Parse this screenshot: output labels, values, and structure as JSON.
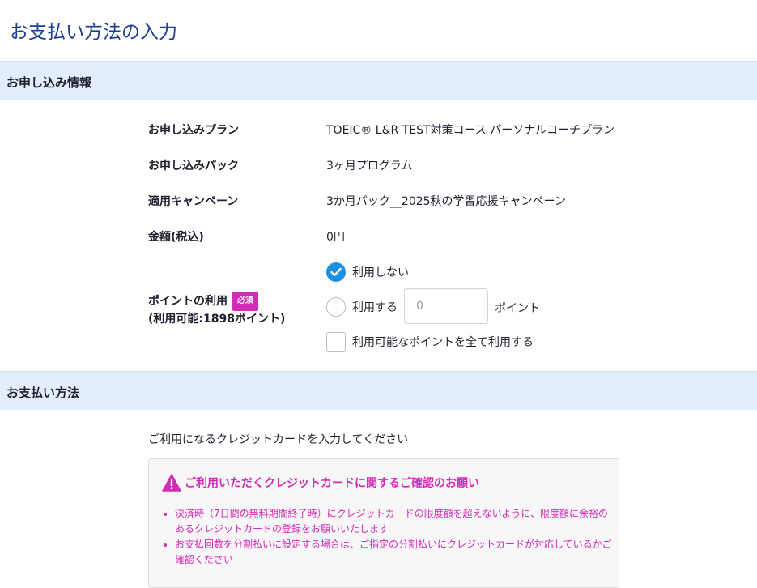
{
  "page": {
    "title": "お支払い方法の入力"
  },
  "application_section": {
    "header": "お申し込み情報",
    "rows": [
      {
        "label": "お申し込みプラン",
        "value": "TOEIC® L&R TEST対策コース パーソナルコーチプラン"
      },
      {
        "label": "お申し込みパック",
        "value": "3ヶ月プログラム"
      },
      {
        "label": "適用キャンペーン",
        "value": "3か月パック__2025秋の学習応援キャンペーン"
      },
      {
        "label": "金額(税込)",
        "value": "0円"
      }
    ],
    "points": {
      "label": "ポイントの利用",
      "required_badge": "必須",
      "available": "(利用可能:1898ポイント)",
      "option_not_use": "利用しない",
      "option_use": "利用する",
      "input_placeholder": "0",
      "unit": "ポイント",
      "use_all_label": "利用可能なポイントを全て利用する",
      "selected": "not_use"
    }
  },
  "payment_section": {
    "header": "お支払い方法",
    "instruction": "ご利用になるクレジットカードを入力してください",
    "notice": {
      "title": "ご利用いただくクレジットカードに関するご確認のお願い",
      "items": [
        "決済時（7日間の無料期間終了時）にクレジットカードの限度額を超えないように、限度額に余裕のあるクレジットカードの登録をお願いいたします",
        "お支払回数を分割払いに設定する場合は、ご指定の分割払いにクレジットカードが対応しているかご確認ください"
      ]
    }
  },
  "colors": {
    "title": "#1c3f8f",
    "section_bg": "#e3eefb",
    "accent_blue": "#1e8fe1",
    "warning_magenta": "#d42ab8"
  }
}
